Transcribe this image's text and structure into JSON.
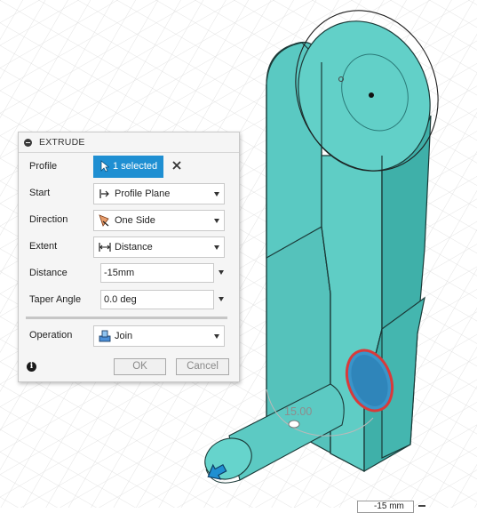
{
  "panel": {
    "title": "EXTRUDE",
    "rows": {
      "profile": {
        "label": "Profile",
        "value": "1 selected"
      },
      "start": {
        "label": "Start",
        "value": "Profile Plane"
      },
      "direction": {
        "label": "Direction",
        "value": "One Side"
      },
      "extent": {
        "label": "Extent",
        "value": "Distance"
      },
      "distance": {
        "label": "Distance",
        "value": "-15mm"
      },
      "taper": {
        "label": "Taper Angle",
        "value": "0.0 deg"
      },
      "operation": {
        "label": "Operation",
        "value": "Join"
      }
    },
    "ok_label": "OK",
    "cancel_label": "Cancel"
  },
  "viewport": {
    "dimension_label": "15.00",
    "dimension_input": "-15 mm"
  },
  "colors": {
    "body": "#60cdc6",
    "accent": "#1f8fd2",
    "selected_profile": "#d93a3a"
  },
  "icons": [
    "collapse-icon",
    "cursor-icon",
    "close-icon",
    "start-plane-icon",
    "direction-icon",
    "distance-extent-icon",
    "join-icon",
    "info-icon",
    "drag-arrow-icon"
  ]
}
